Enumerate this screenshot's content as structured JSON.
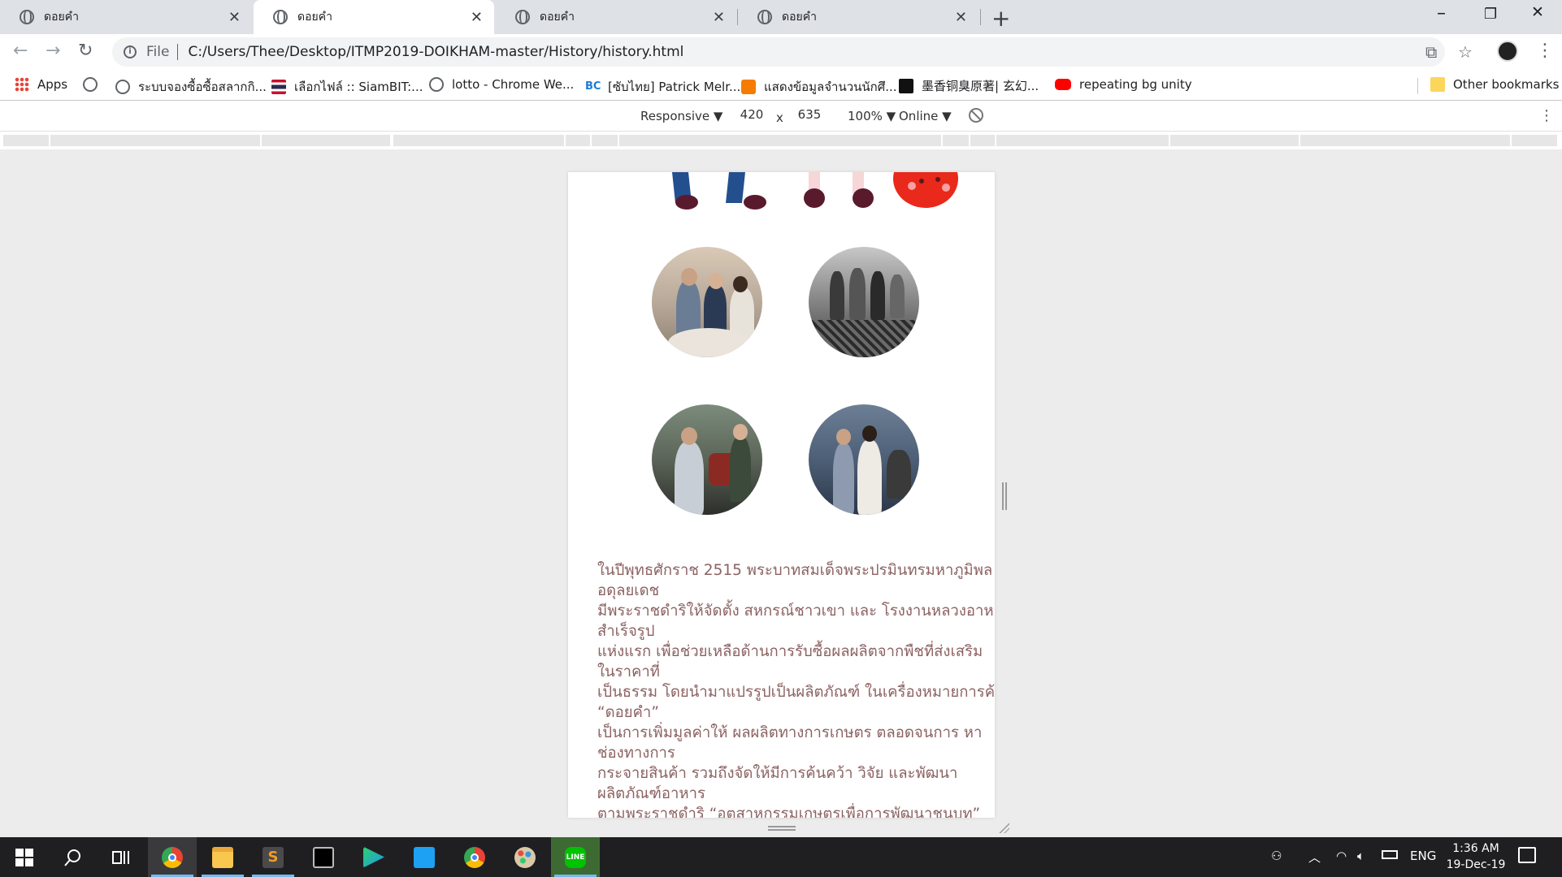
{
  "browser": {
    "tabs": [
      {
        "title": "ดอยคำ",
        "active": false
      },
      {
        "title": "ดอยคำ",
        "active": true
      },
      {
        "title": "ดอยคำ",
        "active": false
      },
      {
        "title": "ดอยคำ",
        "active": false
      }
    ],
    "new_tab_symbol": "+",
    "window_controls": {
      "minimize": "–",
      "restore": "❐",
      "close": "✕"
    },
    "address": {
      "scheme_label": "File",
      "url": "C:/Users/Thee/Desktop/ITMP2019-DOIKHAM-master/History/history.html"
    },
    "nav": {
      "back": "←",
      "forward": "→",
      "reload": "↻"
    }
  },
  "bookmarks": {
    "items": [
      {
        "label": "Apps",
        "icon": "apps-grid-icon"
      },
      {
        "label": "",
        "icon": "globe-icon"
      },
      {
        "label": "ระบบจองซื้อซื้อสลากกิ...",
        "icon": "globe-icon"
      },
      {
        "label": "เลือกไฟล์ :: SiamBIT:...",
        "icon": "flag-icon"
      },
      {
        "label": "lotto - Chrome We...",
        "icon": "globe-icon"
      },
      {
        "label": "[ซับไทย] Patrick Melr...",
        "icon": "bc-icon"
      },
      {
        "label": "แสดงข้อมูลจำนวนนักศึ...",
        "icon": "chart-icon"
      },
      {
        "label": "墨香铜臭原著| 玄幻...",
        "icon": "wolf-icon"
      },
      {
        "label": "repeating bg unity",
        "icon": "youtube-icon"
      }
    ],
    "other": "Other bookmarks"
  },
  "devtools": {
    "device": "Responsive ▼",
    "width": "420",
    "times": "x",
    "height": "635",
    "zoom": "100% ▼",
    "throttle": "Online ▼"
  },
  "page": {
    "history_lines": [
      "ในปีพุทธศักราช 2515 พระบาทสมเด็จพระปรมินทรมหาภูมิพล",
      "อดุลยเดช",
      "มีพระราชดำริให้จัดตั้ง สหกรณ์ชาวเขา และ โรงงานหลวงอาหาร",
      "สำเร็จรูป",
      "แห่งแรก เพื่อช่วยเหลือด้านการรับซื้อผลผลิตจากพืชที่ส่งเสริม",
      "ในราคาที่",
      "เป็นธรรม โดยนำมาแปรรูปเป็นผลิตภัณฑ์ ในเครื่องหมายการค้า",
      "“ดอยคำ”",
      "เป็นการเพิ่มมูลค่าให้ ผลผลิตทางการเกษตร ตลอดจนการ หา",
      "ช่องทางการ",
      "กระจายสินค้า รวมถึงจัดให้มีการค้นคว้า วิจัย และพัฒนา",
      "ผลิตภัณฑ์อาหาร",
      "ตามพระราชดำริ “อุตสาหกรรมเกษตรเพื่อการพัฒนาชนบท”"
    ],
    "text_color": "#8c6262"
  },
  "taskbar": {
    "language": "ENG",
    "time": "1:36 AM",
    "date": "19-Dec-19"
  }
}
